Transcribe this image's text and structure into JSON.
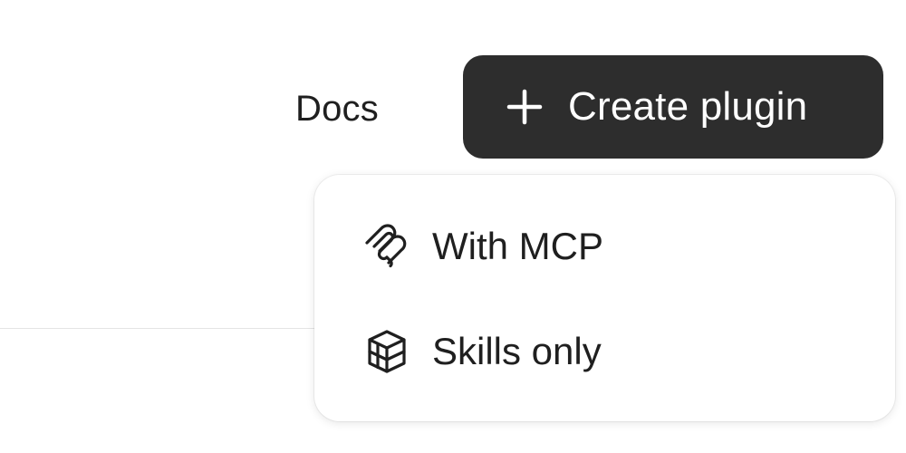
{
  "header": {
    "docs_label": "Docs",
    "create_button_label": "Create plugin"
  },
  "dropdown": {
    "items": [
      {
        "label": "With MCP",
        "icon": "mcp-icon"
      },
      {
        "label": "Skills only",
        "icon": "cube-icon"
      }
    ]
  },
  "colors": {
    "button_background": "#2d2d2d",
    "button_text": "#ffffff",
    "text": "#1f1f1f",
    "menu_background": "#ffffff"
  }
}
